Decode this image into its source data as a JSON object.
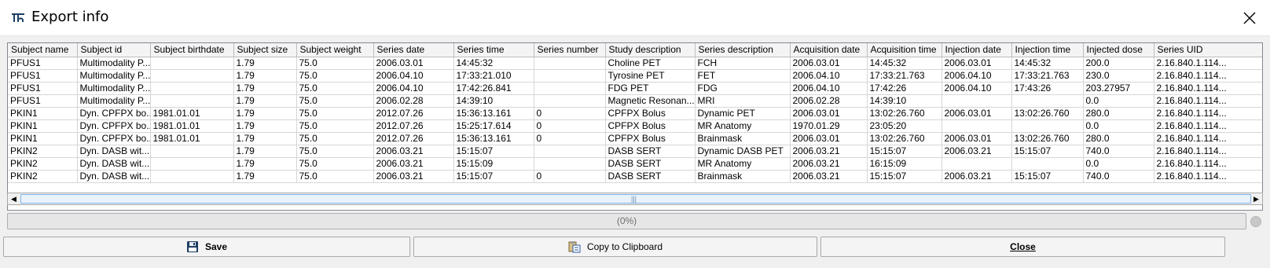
{
  "window": {
    "title": "Export info",
    "close_label": "×"
  },
  "table": {
    "columns": [
      "Subject name",
      "Subject id",
      "Subject birthdate",
      "Subject size",
      "Subject weight",
      "Series date",
      "Series time",
      "Series number",
      "Study description",
      "Series description",
      "Acquisition date",
      "Acquisition time",
      "Injection date",
      "Injection time",
      "Injected dose",
      "Series UID"
    ],
    "rows": [
      [
        "PFUS1",
        "Multimodality P...",
        "",
        "1.79",
        "75.0",
        "2006.03.01",
        "14:45:32",
        "",
        "Choline PET",
        "FCH",
        "2006.03.01",
        "14:45:32",
        "2006.03.01",
        "14:45:32",
        "200.0",
        "2.16.840.1.114..."
      ],
      [
        "PFUS1",
        "Multimodality P...",
        "",
        "1.79",
        "75.0",
        "2006.04.10",
        "17:33:21.010",
        "",
        "Tyrosine PET",
        "FET",
        "2006.04.10",
        "17:33:21.763",
        "2006.04.10",
        "17:33:21.763",
        "230.0",
        "2.16.840.1.114..."
      ],
      [
        "PFUS1",
        "Multimodality P...",
        "",
        "1.79",
        "75.0",
        "2006.04.10",
        "17:42:26.841",
        "",
        "FDG PET",
        "FDG",
        "2006.04.10",
        "17:42:26",
        "2006.04.10",
        "17:43:26",
        "203.27957",
        "2.16.840.1.114..."
      ],
      [
        "PFUS1",
        "Multimodality P...",
        "",
        "1.79",
        "75.0",
        "2006.02.28",
        "14:39:10",
        "",
        "Magnetic Resonan...",
        "MRI",
        "2006.02.28",
        "14:39:10",
        "",
        "",
        "0.0",
        "2.16.840.1.114..."
      ],
      [
        "PKIN1",
        "Dyn. CPFPX bo...",
        "1981.01.01",
        "1.79",
        "75.0",
        "2012.07.26",
        "15:36:13.161",
        "0",
        "CPFPX Bolus",
        "Dynamic PET",
        "2006.03.01",
        "13:02:26.760",
        "2006.03.01",
        "13:02:26.760",
        "280.0",
        "2.16.840.1.114..."
      ],
      [
        "PKIN1",
        "Dyn. CPFPX bo...",
        "1981.01.01",
        "1.79",
        "75.0",
        "2012.07.26",
        "15:25:17.614",
        "0",
        "CPFPX Bolus",
        "MR Anatomy",
        "1970.01.29",
        "23:05:20",
        "",
        "",
        "0.0",
        "2.16.840.1.114..."
      ],
      [
        "PKIN1",
        "Dyn. CPFPX bo...",
        "1981.01.01",
        "1.79",
        "75.0",
        "2012.07.26",
        "15:36:13.161",
        "0",
        "CPFPX Bolus",
        "Brainmask",
        "2006.03.01",
        "13:02:26.760",
        "2006.03.01",
        "13:02:26.760",
        "280.0",
        "2.16.840.1.114..."
      ],
      [
        "PKIN2",
        "Dyn. DASB wit...",
        "",
        "1.79",
        "75.0",
        "2006.03.21",
        "15:15:07",
        "",
        "DASB SERT",
        "Dynamic DASB PET",
        "2006.03.21",
        "15:15:07",
        "2006.03.21",
        "15:15:07",
        "740.0",
        "2.16.840.1.114..."
      ],
      [
        "PKIN2",
        "Dyn. DASB wit...",
        "",
        "1.79",
        "75.0",
        "2006.03.21",
        "15:15:09",
        "",
        "DASB SERT",
        "MR Anatomy",
        "2006.03.21",
        "16:15:09",
        "",
        "",
        "0.0",
        "2.16.840.1.114..."
      ],
      [
        "PKIN2",
        "Dyn. DASB wit...",
        "",
        "1.79",
        "75.0",
        "2006.03.21",
        "15:15:07",
        "0",
        "DASB SERT",
        "Brainmask",
        "2006.03.21",
        "15:15:07",
        "2006.03.21",
        "15:15:07",
        "740.0",
        "2.16.840.1.114..."
      ]
    ]
  },
  "scrollbar": {
    "left_arrow": "◀",
    "right_arrow": "▶",
    "grip": "|||"
  },
  "progress": {
    "text": "(0%)",
    "value": 0
  },
  "buttons": {
    "save": "Save",
    "copy": "Copy to Clipboard",
    "close": "Close"
  },
  "icons": {
    "app": "pmod-logo-icon",
    "save": "floppy-disk-icon",
    "copy": "clipboard-copy-icon"
  }
}
